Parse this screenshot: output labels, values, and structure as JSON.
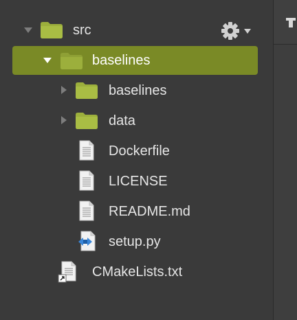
{
  "tree": {
    "items": [
      {
        "label": "src",
        "type": "folder",
        "expanded": true
      },
      {
        "label": "baselines",
        "type": "folder",
        "expanded": true,
        "selected": true
      },
      {
        "label": "baselines",
        "type": "folder",
        "expanded": false
      },
      {
        "label": "data",
        "type": "folder",
        "expanded": false
      },
      {
        "label": "Dockerfile",
        "type": "file"
      },
      {
        "label": "LICENSE",
        "type": "file"
      },
      {
        "label": "README.md",
        "type": "file"
      },
      {
        "label": "setup.py",
        "type": "python-file"
      },
      {
        "label": "CMakeLists.txt",
        "type": "shortcut-file"
      }
    ]
  },
  "icons": {
    "settings": "gear-icon",
    "toolbar": "toolbar-icon"
  },
  "colors": {
    "background": "#3a3a3a",
    "selection": "#7a8a26",
    "folder": "#9caf3c",
    "text": "#e6e6e6"
  }
}
